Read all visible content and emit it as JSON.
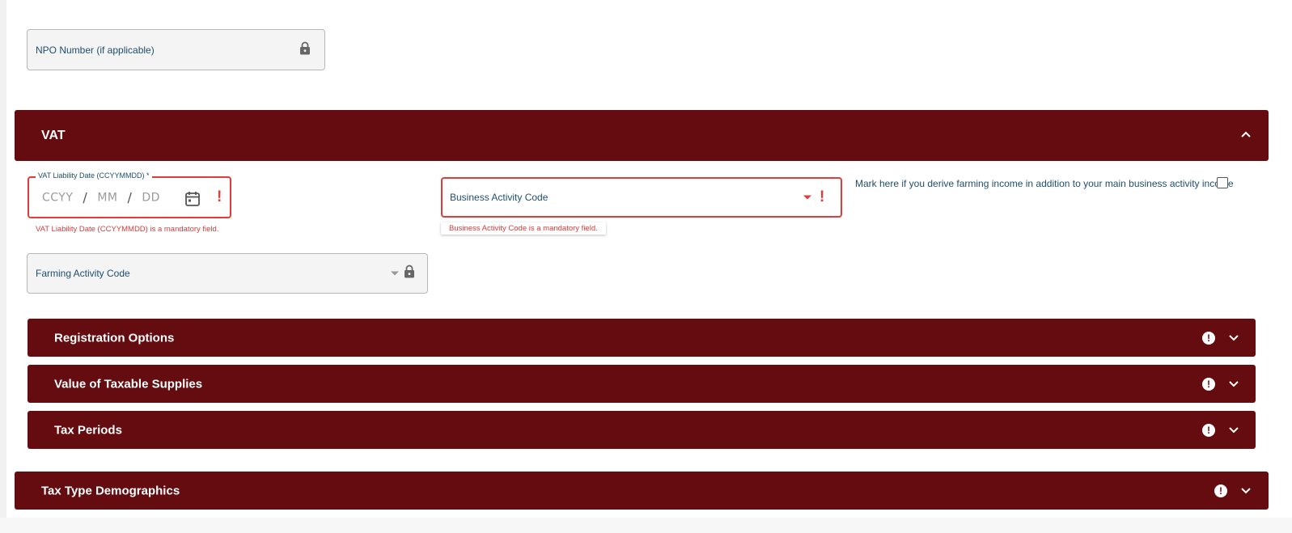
{
  "npo": {
    "label": "NPO Number (if applicable)"
  },
  "vat": {
    "title": "VAT",
    "liability_date": {
      "label": "VAT Liability Date (CCYYMMDD) *",
      "yyyy": "CCYY",
      "mm": "MM",
      "dd": "DD",
      "sep": "/",
      "error": "VAT Liability Date (CCYYMMDD) is a mandatory field.",
      "alert": "!"
    },
    "business_activity": {
      "label": "Business Activity Code",
      "error": "Business Activity Code is a mandatory field.",
      "alert": "!"
    },
    "farming_checkbox": {
      "label": "Mark here if you derive farming income in addition to your main business activity income"
    },
    "farming_activity": {
      "label": "Farming Activity Code"
    }
  },
  "subsections": [
    {
      "title": "Registration Options",
      "alert": "!"
    },
    {
      "title": "Value of Taxable Supplies",
      "alert": "!"
    },
    {
      "title": "Tax Periods",
      "alert": "!"
    }
  ],
  "demographics": {
    "title": "Tax Type Demographics",
    "alert": "!"
  },
  "colors": {
    "section_bar": "#640c0f",
    "error": "#e23b3b",
    "label_text": "#1f4e6e"
  },
  "icons": [
    "lock-icon",
    "calendar-icon",
    "chevron-up-icon",
    "chevron-down-icon",
    "alert-icon",
    "caret-down-icon"
  ]
}
